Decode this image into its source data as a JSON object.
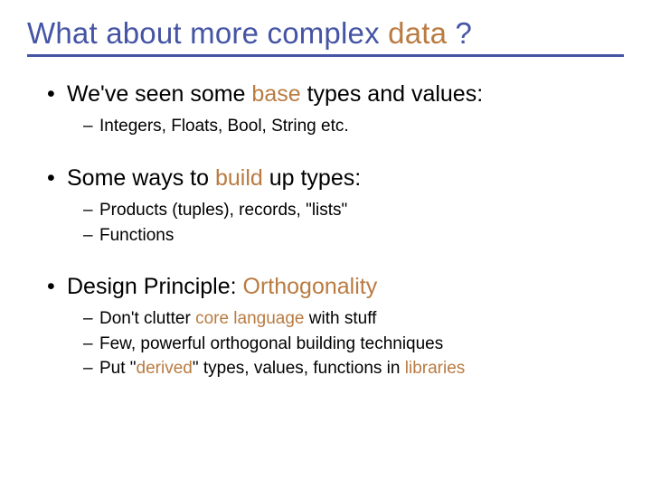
{
  "title": {
    "pre": "What about more complex ",
    "accent": "data",
    "post": " ?"
  },
  "bullets": [
    {
      "segments": [
        {
          "t": "We've seen some "
        },
        {
          "t": "base",
          "accent": true
        },
        {
          "t": " types and values:"
        }
      ],
      "sub": [
        [
          {
            "t": "Integers, Floats, Bool, String etc."
          }
        ]
      ]
    },
    {
      "segments": [
        {
          "t": "Some ways to "
        },
        {
          "t": "build",
          "accent": true
        },
        {
          "t": " up types:"
        }
      ],
      "sub": [
        [
          {
            "t": "Products (tuples), records, \"lists\""
          }
        ],
        [
          {
            "t": "Functions"
          }
        ]
      ]
    },
    {
      "segments": [
        {
          "t": "Design Principle: "
        },
        {
          "t": "Orthogonality",
          "accent": true
        }
      ],
      "sub": [
        [
          {
            "t": "Don't clutter "
          },
          {
            "t": "core language",
            "accent": true
          },
          {
            "t": " with stuff"
          }
        ],
        [
          {
            "t": "Few, powerful orthogonal building techniques"
          }
        ],
        [
          {
            "t": "Put \""
          },
          {
            "t": "derived",
            "accent": true
          },
          {
            "t": "\" types, values, functions in "
          },
          {
            "t": "libraries",
            "accent": true
          }
        ]
      ]
    }
  ]
}
